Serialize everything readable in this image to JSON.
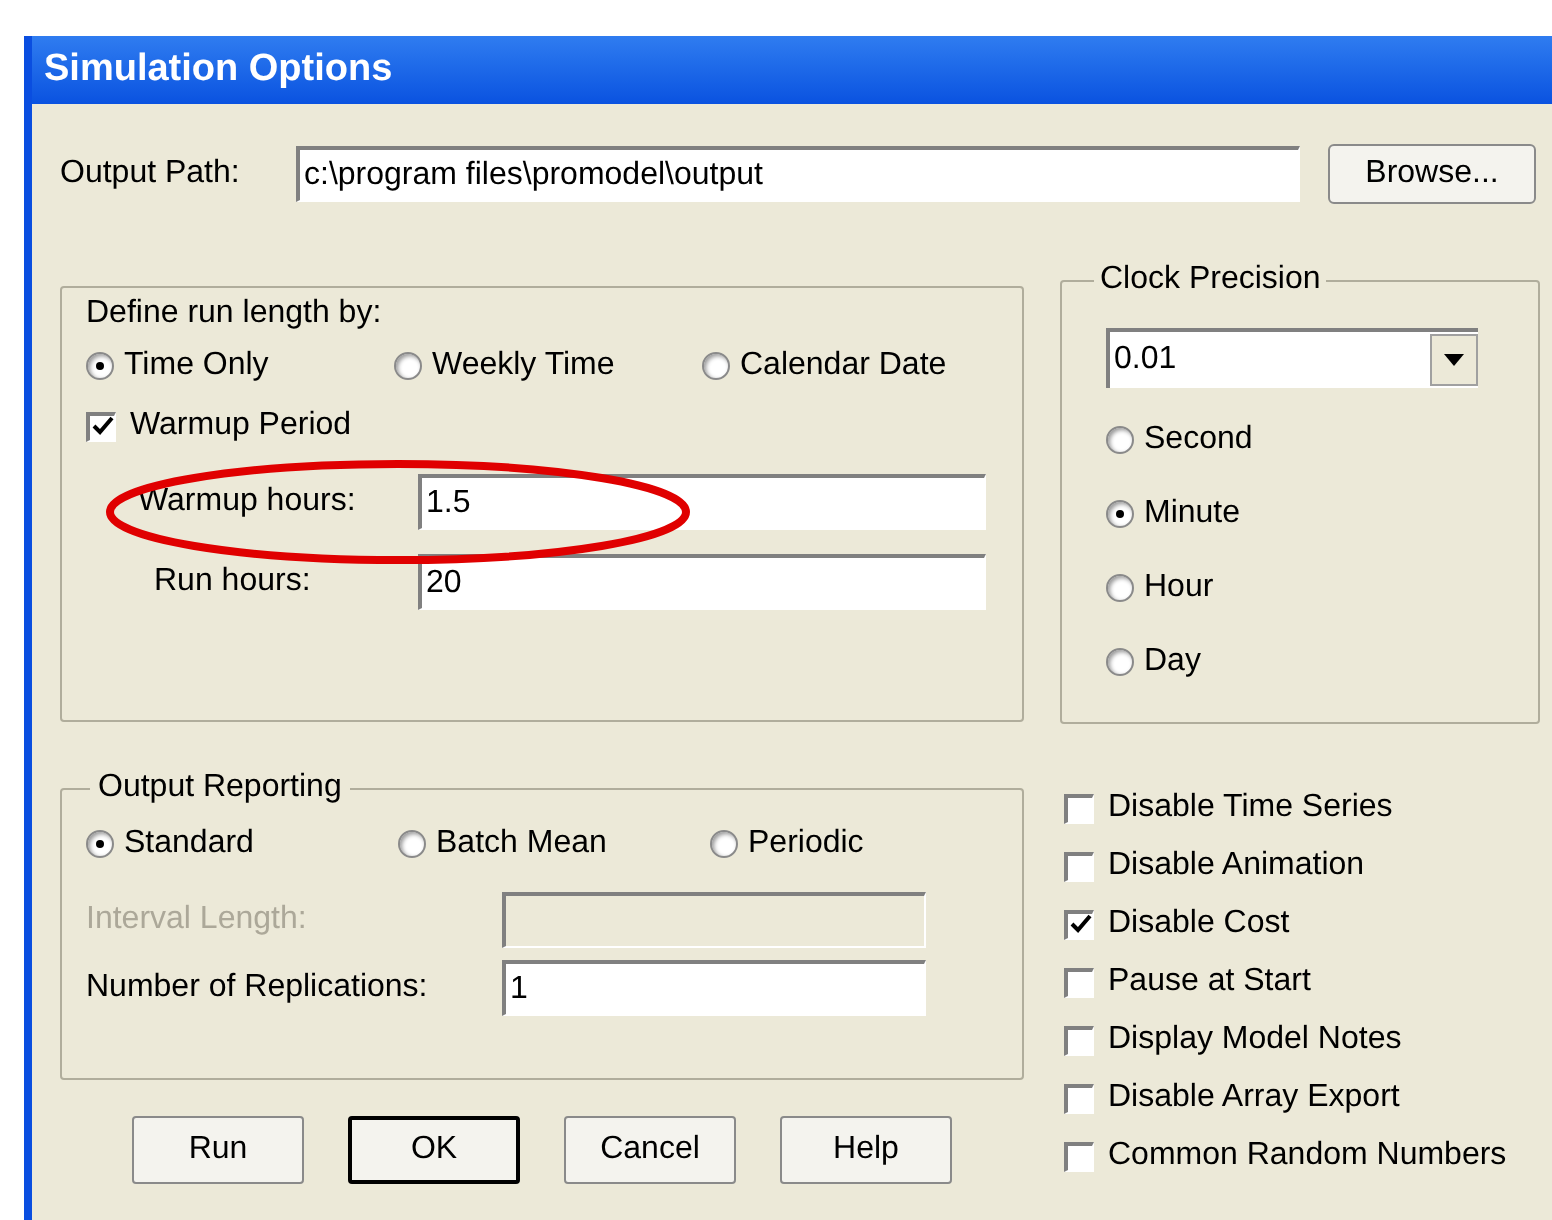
{
  "window": {
    "title": "Simulation Options"
  },
  "output_path": {
    "label": "Output Path:",
    "value": "c:\\program files\\promodel\\output"
  },
  "browse_button": {
    "label": "Browse..."
  },
  "run_length": {
    "label": "Define run length by:",
    "options": [
      {
        "label": "Time Only",
        "selected": true
      },
      {
        "label": "Weekly Time",
        "selected": false
      },
      {
        "label": "Calendar Date",
        "selected": false
      }
    ],
    "warmup": {
      "label": "Warmup Period",
      "checked": true
    },
    "fields": [
      {
        "label": "Warmup hours:",
        "value": "1.5"
      },
      {
        "label": "Run hours:",
        "value": "20"
      }
    ]
  },
  "clock_precision": {
    "title": "Clock Precision",
    "value": "0.01",
    "options": [
      {
        "label": "Second",
        "selected": false
      },
      {
        "label": "Minute",
        "selected": true
      },
      {
        "label": "Hour",
        "selected": false
      },
      {
        "label": "Day",
        "selected": false
      }
    ]
  },
  "output_reporting": {
    "title": "Output Reporting",
    "options": [
      {
        "label": "Standard",
        "selected": true
      },
      {
        "label": "Batch Mean",
        "selected": false
      },
      {
        "label": "Periodic",
        "selected": false
      }
    ],
    "fields": [
      {
        "label": "Interval Length:",
        "disabled": true
      },
      {
        "label": "Number of Replications:",
        "value": "1",
        "disabled": false
      }
    ]
  },
  "checkboxes": [
    {
      "label": "Disable Time Series",
      "checked": false
    },
    {
      "label": "Disable Animation",
      "checked": false
    },
    {
      "label": "Disable Cost",
      "checked": true
    },
    {
      "label": "Pause at Start",
      "checked": false
    },
    {
      "label": "Display Model Notes",
      "checked": false
    },
    {
      "label": "Disable Array Export",
      "checked": false
    },
    {
      "label": "Common Random Numbers",
      "checked": false
    }
  ],
  "buttons": [
    {
      "label": "Run",
      "default": false
    },
    {
      "label": "OK",
      "default": true
    },
    {
      "label": "Cancel",
      "default": false
    },
    {
      "label": "Help",
      "default": false
    }
  ]
}
